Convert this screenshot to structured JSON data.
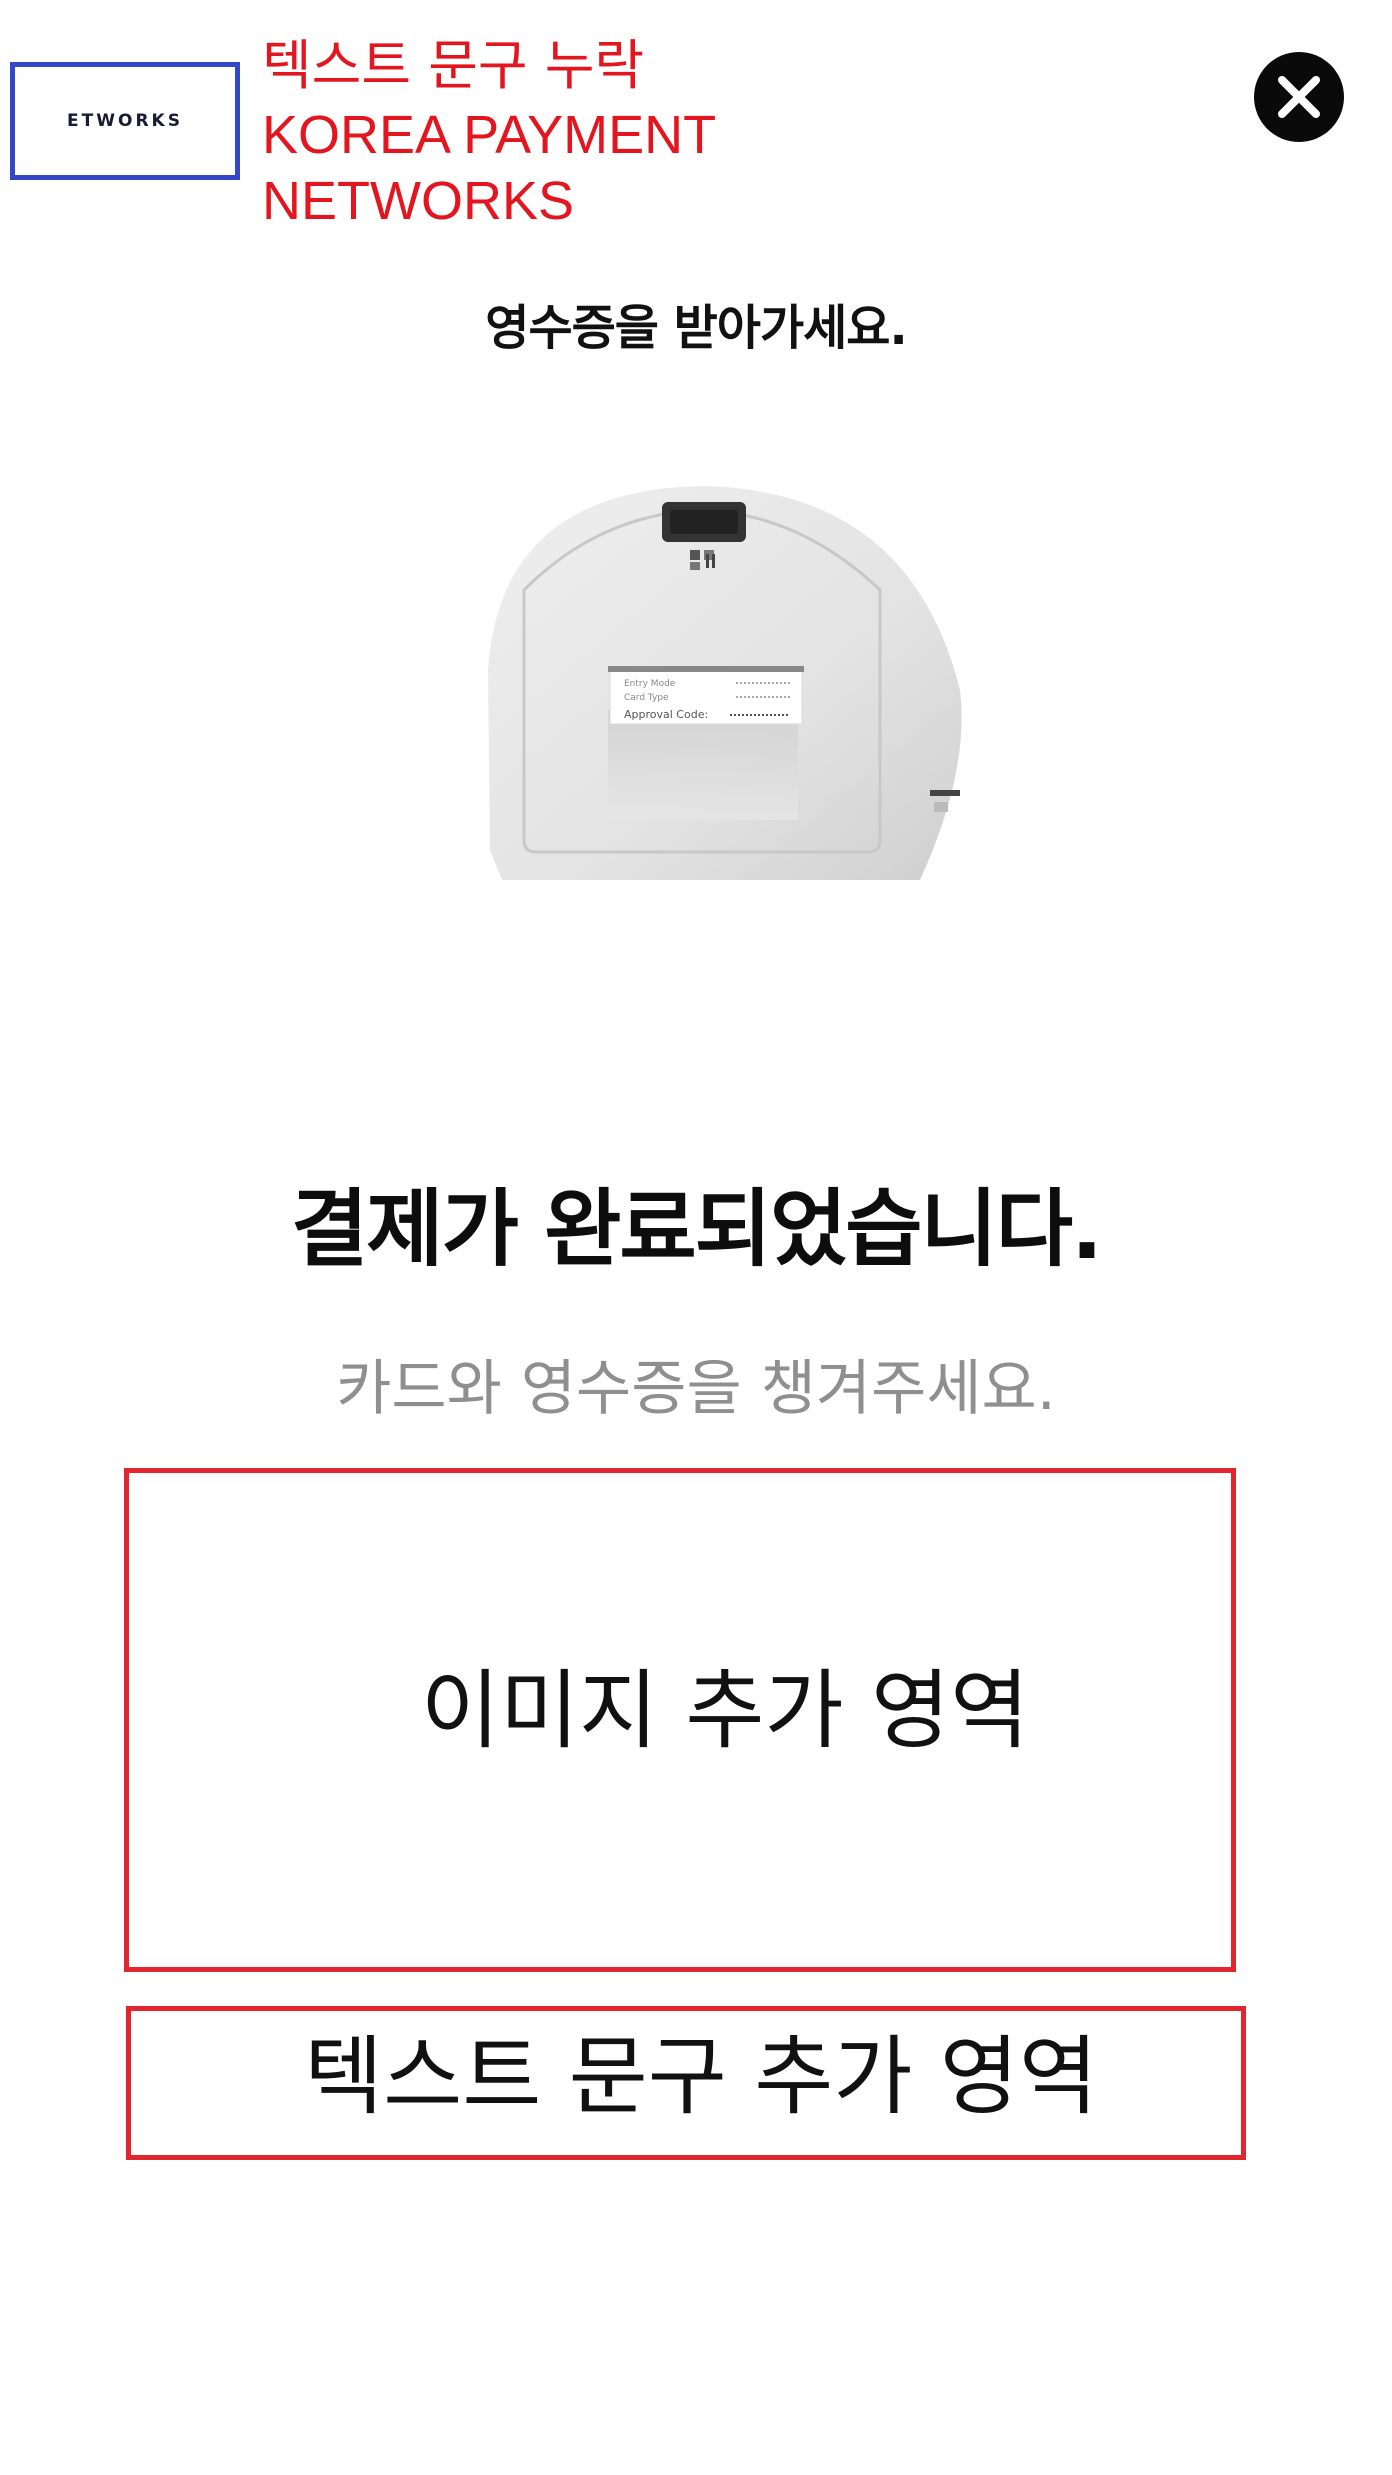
{
  "header": {
    "logo_text": "ETWORKS",
    "annotation_missing": "텍스트 문구 누락",
    "annotation_company": "KOREA PAYMENT\nNETWORKS",
    "close_icon": "close-icon"
  },
  "receipt_heading": "영수증을 받아가세요.",
  "printer": {
    "receipt_lines": [
      "Entry Mode",
      "Card Type",
      "Approval Code:"
    ]
  },
  "completion": {
    "title": "결제가 완료되었습니다.",
    "subtitle": "카드와 영수증을 챙겨주세요."
  },
  "placeholders": {
    "image_area_label": "이미지 추가 영역",
    "text_area_label": "텍스트 문구 추가 영역"
  },
  "colors": {
    "annotation_red": "#e3161f",
    "logo_border_blue": "#3447c9",
    "subtitle_gray": "#8f8f8f"
  }
}
